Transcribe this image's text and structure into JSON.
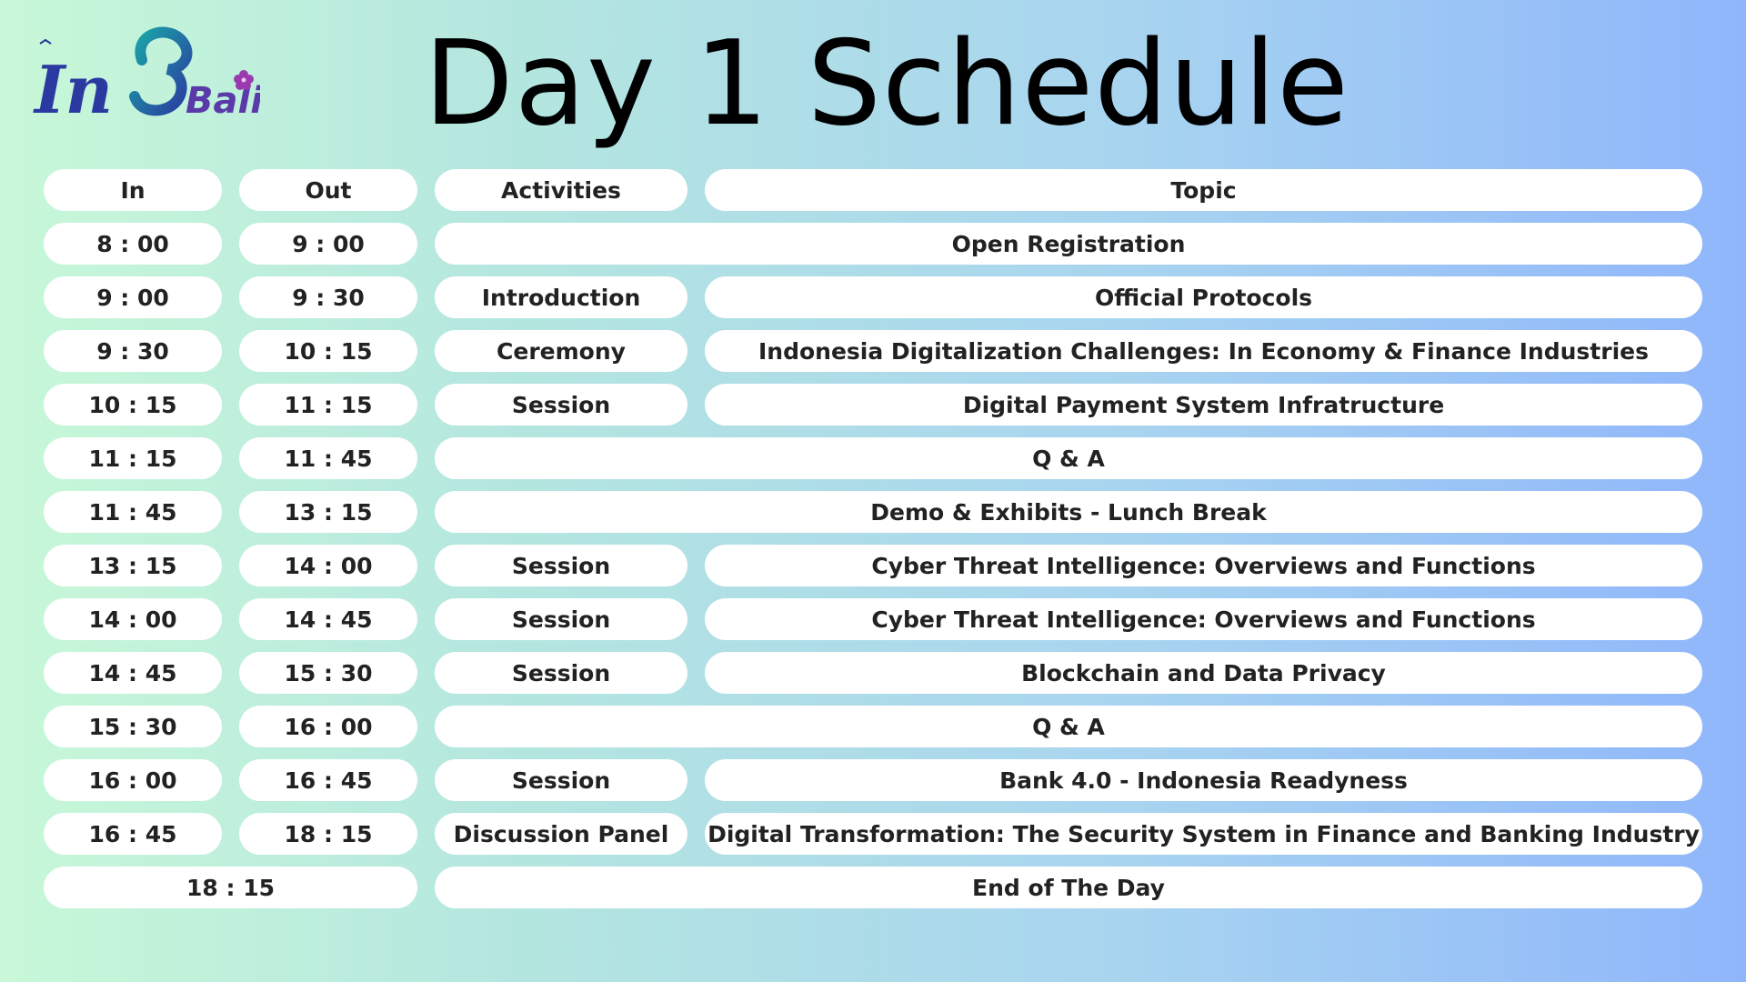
{
  "logo": {
    "text_part1": "In",
    "text_part2": "Bali",
    "icon": "hibiscus-flower-icon"
  },
  "title": "Day 1 Schedule",
  "headers": {
    "in": "In",
    "out": "Out",
    "activities": "Activities",
    "topic": "Topic"
  },
  "rows": [
    {
      "in": "8 : 00",
      "out": "9 : 00",
      "activity": "",
      "topic": "Open Registration"
    },
    {
      "in": "9 : 00",
      "out": "9 : 30",
      "activity": "Introduction",
      "topic": "Official Protocols"
    },
    {
      "in": "9 : 30",
      "out": "10 : 15",
      "activity": "Ceremony",
      "topic": "Indonesia Digitalization Challenges: In Economy & Finance Industries"
    },
    {
      "in": "10 : 15",
      "out": "11 : 15",
      "activity": "Session",
      "topic": "Digital Payment System Infratructure"
    },
    {
      "in": "11 : 15",
      "out": "11 : 45",
      "activity": "",
      "topic": "Q & A"
    },
    {
      "in": "11 : 45",
      "out": "13 : 15",
      "activity": "",
      "topic": "Demo & Exhibits - Lunch Break"
    },
    {
      "in": "13 : 15",
      "out": "14 : 00",
      "activity": "Session",
      "topic": "Cyber Threat Intelligence: Overviews and Functions"
    },
    {
      "in": "14 : 00",
      "out": "14 : 45",
      "activity": "Session",
      "topic": "Cyber Threat Intelligence: Overviews and Functions"
    },
    {
      "in": "14 : 45",
      "out": "15 : 30",
      "activity": "Session",
      "topic": "Blockchain and Data Privacy"
    },
    {
      "in": "15 : 30",
      "out": "16 : 00",
      "activity": "",
      "topic": "Q & A"
    },
    {
      "in": "16 : 00",
      "out": "16 : 45",
      "activity": "Session",
      "topic": "Bank 4.0 - Indonesia Readyness"
    },
    {
      "in": "16 : 45",
      "out": "18 : 15",
      "activity": "Discussion Panel",
      "topic": "Digital Transformation: The Security System in Finance and Banking Industry"
    },
    {
      "in": "18 : 15",
      "out": "",
      "activity": "",
      "topic": "End of The Day"
    }
  ]
}
